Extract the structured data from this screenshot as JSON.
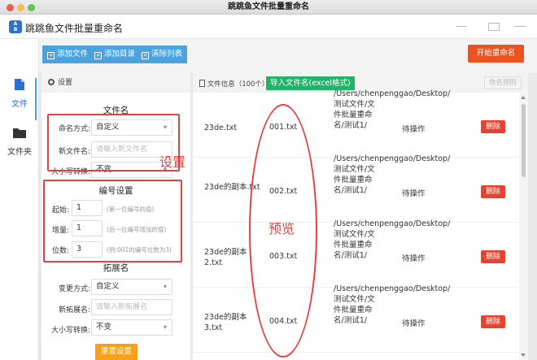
{
  "window": {
    "title": "跳跳鱼文件批量重命名"
  },
  "app": {
    "title": "跳跳鱼文件批量重命名",
    "logo_text": "A B"
  },
  "toolbar": {
    "add_file": "添加文件",
    "add_dir": "添加目录",
    "clear_list": "清除列表",
    "start": "开始重命名"
  },
  "sidebar": {
    "items": [
      {
        "label": "文件",
        "icon": "file-icon",
        "active": true
      },
      {
        "label": "文件夹",
        "icon": "folder-icon",
        "active": false
      }
    ]
  },
  "settings": {
    "header": "设置",
    "filename": {
      "title": "文件名",
      "mode_label": "命名方式:",
      "mode_value": "自定义",
      "newname_label": "新文件名:",
      "newname_placeholder": "请输入新文件名",
      "case_label": "大小写转换:",
      "case_value": "不变"
    },
    "numbering": {
      "title": "编号设置",
      "start_label": "起始:",
      "start_value": "1",
      "start_hint": "(第一位编号的值)",
      "step_label": "增量:",
      "step_value": "1",
      "step_hint": "(后一位编号增加的值)",
      "digits_label": "位数:",
      "digits_value": "3",
      "digits_hint": "(例:001的编号位数为3)"
    },
    "extension": {
      "title": "拓展名",
      "mode_label": "变更方式:",
      "mode_value": "自定义",
      "newext_label": "新拓展名:",
      "newext_placeholder": "请输入新拓展名",
      "case_label": "大小写转换:",
      "case_value": "不变"
    },
    "reset": "重置设置"
  },
  "annotations": {
    "settings": "设置",
    "preview": "预览"
  },
  "filelist": {
    "header": "文件信息（100个）",
    "import_excel": "导入文件名(excel格式)",
    "name_rule": "命名规则",
    "rows": [
      {
        "orig": "23de.txt",
        "new": "001.txt",
        "path": "/Users/chenpenggao/Desktop/测试文件/文件批量重命名/测试1/",
        "status": "待操作",
        "action": "删除"
      },
      {
        "orig": "23de的副本.txt",
        "new": "002.txt",
        "path": "/Users/chenpenggao/Desktop/测试文件/文件批量重命名/测试1/",
        "status": "待操作",
        "action": "删除"
      },
      {
        "orig": "23de的副本2.txt",
        "new": "003.txt",
        "path": "/Users/chenpenggao/Desktop/测试文件/文件批量重命名/测试1/",
        "status": "待操作",
        "action": "删除"
      },
      {
        "orig": "23de的副本3.txt",
        "new": "004.txt",
        "path": "/Users/chenpenggao/Desktop/测试文件/文件批量重命名/测试1/",
        "status": "待操作",
        "action": "删除"
      }
    ]
  },
  "colors": {
    "blue": "#4aa3df",
    "orange_red": "#f0521e",
    "green": "#22b36a",
    "delete_red": "#e8432e",
    "reset_orange": "#f7a11a",
    "annotation_red": "#e83f3f"
  }
}
